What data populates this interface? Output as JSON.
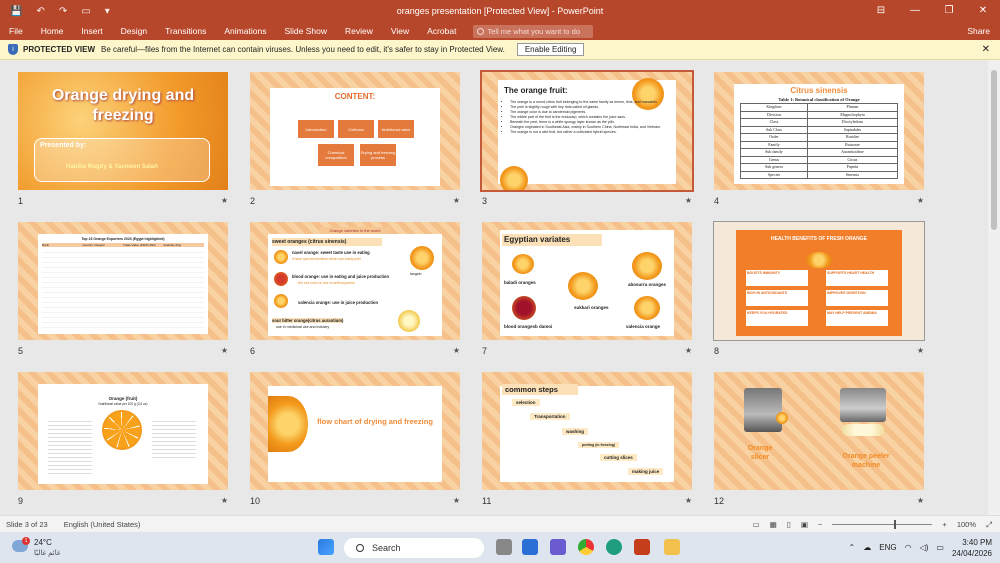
{
  "titlebar": {
    "title": "oranges presentation [Protected View] - PowerPoint",
    "qat": [
      "💾",
      "↶",
      "↷",
      "▭",
      "▾"
    ],
    "win": [
      "⊟",
      "—",
      "❐",
      "✕"
    ]
  },
  "tabs": {
    "items": [
      "File",
      "Home",
      "Insert",
      "Design",
      "Transitions",
      "Animations",
      "Slide Show",
      "Review",
      "View",
      "Acrobat"
    ],
    "search_placeholder": "Tell me what you want to do",
    "share": "Share"
  },
  "protected": {
    "label": "PROTECTED VIEW",
    "message": "Be careful—files from the Internet can contain viruses. Unless you need to edit, it's safer to stay in Protected View.",
    "button": "Enable Editing",
    "close": "✕"
  },
  "slides": [
    {
      "num": "1",
      "title": "Orange drying and freezing",
      "presenter_label": "Presented by:",
      "presenters": "Habiba Magdy & Yasmeen Salah"
    },
    {
      "num": "2",
      "title": "CONTENT:",
      "boxes": [
        "Introduction",
        "Cultivars",
        "Nutritional value",
        "Chemical composition",
        "Drying and freezing process"
      ]
    },
    {
      "num": "3",
      "title": "The orange fruit:",
      "bullets": [
        "The orange is a round citrus fruit belonging to the same family as lemon, lime, and mandarin.",
        "The peel is slightly rough with tiny dots called oil glands.",
        "The orange color is due to carotenoid pigments.",
        "The edible part of the fruit is the endocarp, which contains the juice sacs.",
        "Beneath the peel, there is a white spongy layer known as the pith.",
        "Oranges originated in Southeast Asia, mainly in Southern China, Northeast India, and Vietnam.",
        "The orange is not a wild fruit, but rather a cultivated hybrid species."
      ]
    },
    {
      "num": "4",
      "title": "Citrus sinensis",
      "table_title": "Table 1: Botanical classification of Orange",
      "rows": [
        [
          "Kingdom",
          "Plantae"
        ],
        [
          "Division",
          "Magnoliophyta"
        ],
        [
          "Class",
          "Dicotyledons"
        ],
        [
          "Sub Class",
          "Sapindales"
        ],
        [
          "Order",
          "Rosidae"
        ],
        [
          "Family",
          "Rutaceae"
        ],
        [
          "Sub family",
          "Aurantioideae"
        ],
        [
          "Genus",
          "Citrus"
        ],
        [
          "Sub genera",
          "Papeda"
        ],
        [
          "Species",
          "Sinensis"
        ]
      ]
    },
    {
      "num": "5",
      "title": "Top 15 Orange Exporters 2023 (Egypt highlighted)",
      "headers": [
        "Rank",
        "Country / Region",
        "Trade Value (1000 USD)",
        "Quantity (Kg)"
      ]
    },
    {
      "num": "6",
      "title": "Orange varieties in the world",
      "sweet": "sweet oranges (citrus sinensis)",
      "navel": "navel orange: sweet taste use in eating",
      "navel_note": "it have special seedless which can easily peel",
      "blood": "blood orange: use in eating and juice production",
      "blood_note": "the red color is due to anthocyanins",
      "valencia": "valencia orange: use in juice production",
      "sour": "sour bitter orange(citrus aurantium)",
      "sour_note": "use in medicinal use and industry",
      "tangelo": "tangelo"
    },
    {
      "num": "7",
      "title": "Egyptian variates",
      "labels": [
        "baladi oranges",
        "sukkari oranges",
        "abosurra oranges",
        "blood orangesb damoi",
        "valencia orange"
      ]
    },
    {
      "num": "8",
      "title": "HEALTH BENEFITS OF FRESH ORANGE",
      "benefits": [
        "BOOSTS IMMUNITY",
        "SUPPORTS HEART HEALTH",
        "RICH IN ANTIOXIDANTS",
        "IMPROVES DIGESTION",
        "KEEPS YOU HYDRATED",
        "MAY HELP PREVENT ANEMIA"
      ]
    },
    {
      "num": "9",
      "title": "Orange (fruit)",
      "subtitle": "Nutritional value per 100 g (3.5 oz)"
    },
    {
      "num": "10",
      "title": "flow chart of drying and freezing"
    },
    {
      "num": "11",
      "title": "common steps",
      "steps": [
        "selection",
        "Transportation",
        "washing",
        "peeling (in freezing)",
        "cutting slices",
        "making juice"
      ]
    },
    {
      "num": "12",
      "labels": [
        "Orange slicer",
        "Orange peeler machine"
      ]
    }
  ],
  "status": {
    "slide": "Slide 3 of 23",
    "language": "English (United States)",
    "zoom": "100%"
  },
  "taskbar": {
    "temp": "24°C",
    "weather_text": "غائم غالبًا",
    "badge": "1",
    "search": "Search",
    "lang": "ENG",
    "time": "3:40 PM",
    "date": "24/04/2026"
  },
  "colors": {
    "accent": "#b7472a",
    "orange": "#f39a1d"
  }
}
